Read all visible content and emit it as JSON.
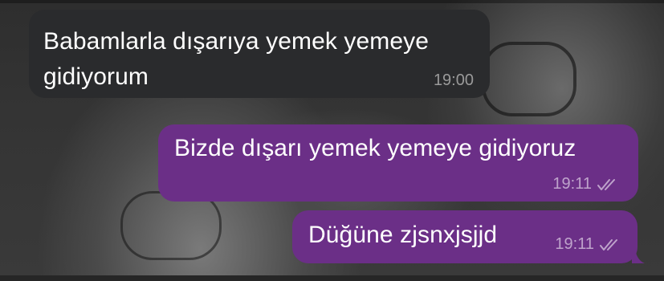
{
  "messages": [
    {
      "direction": "incoming",
      "lines": [
        "Babamlarla dışarıya yemek yemeye",
        "gidiyorum"
      ],
      "time": "19:00"
    },
    {
      "direction": "outgoing",
      "lines": [
        "Bizde dışarı yemek yemeye gidiyoruz"
      ],
      "time": "19:11",
      "status_icon": "double-check-icon"
    },
    {
      "direction": "outgoing",
      "lines": [
        "Düğüne zjsnxjsjjd"
      ],
      "time": "19:11",
      "status_icon": "double-check-icon"
    }
  ],
  "colors": {
    "incoming_bubble": "#2a2b2d",
    "outgoing_bubble": "#6b2f87",
    "message_text": "#ffffff"
  }
}
